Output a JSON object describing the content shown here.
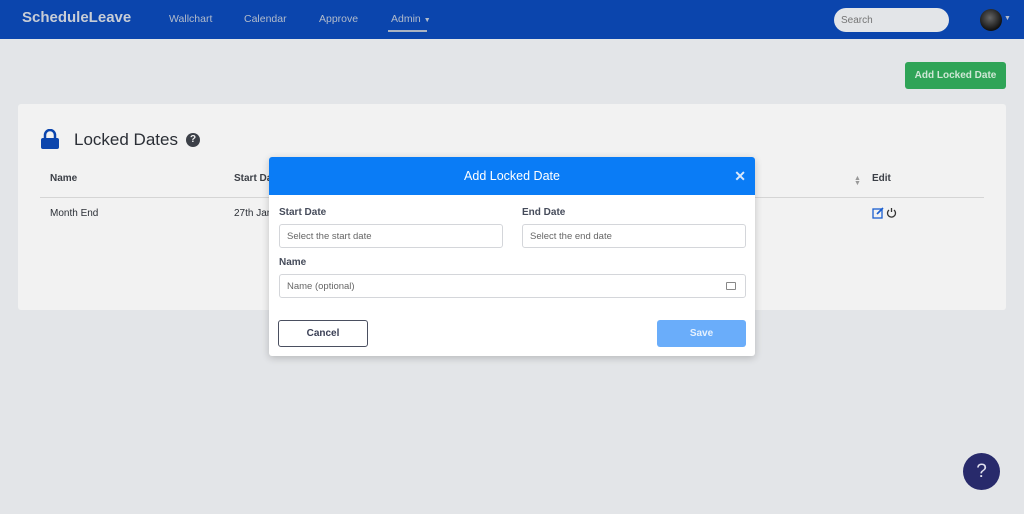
{
  "nav": {
    "brand": "ScheduleLeave",
    "links": [
      "Wallchart",
      "Calendar",
      "Approve",
      "Admin"
    ],
    "search_placeholder": "Search"
  },
  "page": {
    "add_button": "Add Locked Date",
    "title": "Locked Dates",
    "columns": [
      "Name",
      "Start Da",
      "Edit"
    ],
    "rows": [
      {
        "name": "Month End",
        "start": "27th Jan"
      }
    ]
  },
  "modal": {
    "title": "Add Locked Date",
    "start_label": "Start Date",
    "start_placeholder": "Select the start date",
    "end_label": "End Date",
    "end_placeholder": "Select the end date",
    "name_label": "Name",
    "name_placeholder": "Name (optional)",
    "cancel": "Cancel",
    "save": "Save"
  },
  "help_fab": "?",
  "colors": {
    "navbar": "#0b45ad",
    "modal_header": "#0a7cf6",
    "add_button": "#2fa457",
    "save": "#6aadfa"
  }
}
